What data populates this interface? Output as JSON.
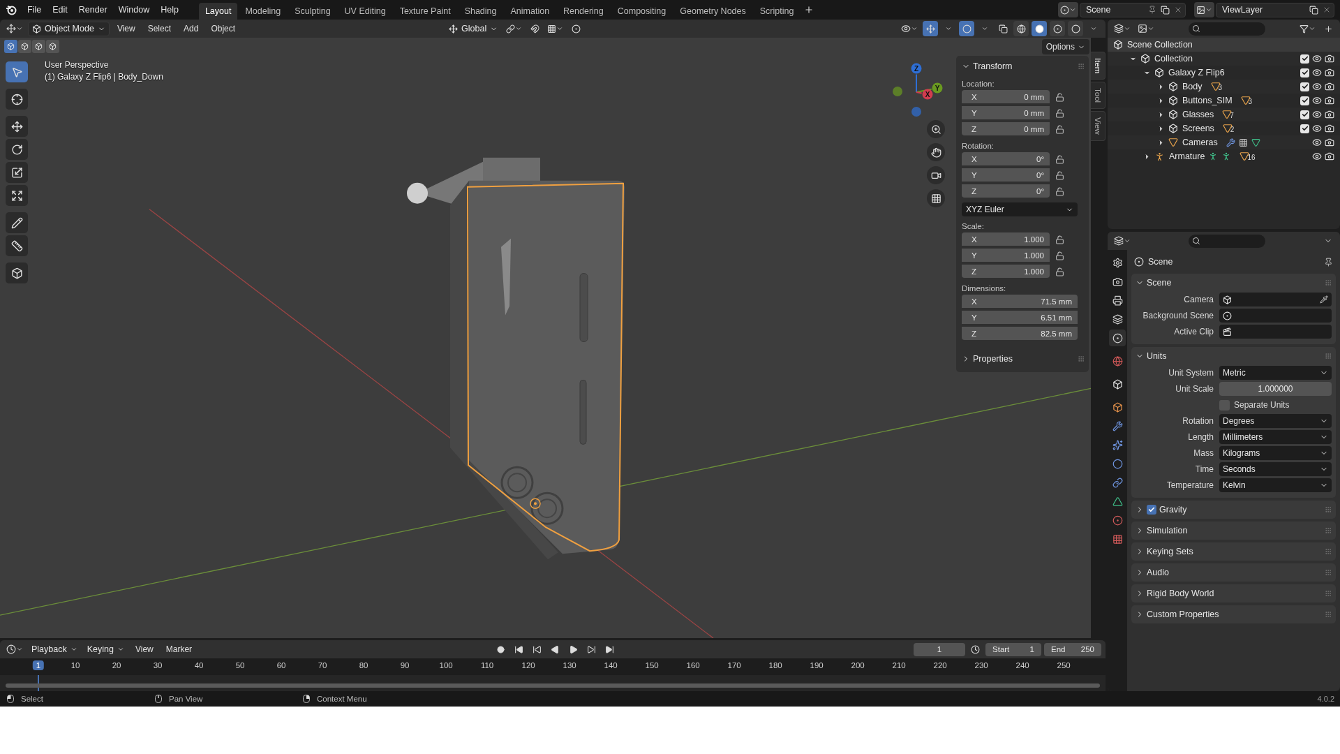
{
  "topbar": {
    "menus": [
      "File",
      "Edit",
      "Render",
      "Window",
      "Help"
    ],
    "workspaces": [
      {
        "label": "Layout",
        "selected": true
      },
      {
        "label": "Modeling",
        "selected": false
      },
      {
        "label": "Sculpting",
        "selected": false
      },
      {
        "label": "UV Editing",
        "selected": false
      },
      {
        "label": "Texture Paint",
        "selected": false
      },
      {
        "label": "Shading",
        "selected": false
      },
      {
        "label": "Animation",
        "selected": false
      },
      {
        "label": "Rendering",
        "selected": false
      },
      {
        "label": "Compositing",
        "selected": false
      },
      {
        "label": "Geometry Nodes",
        "selected": false
      },
      {
        "label": "Scripting",
        "selected": false
      }
    ],
    "scene": "Scene",
    "view_layer": "ViewLayer"
  },
  "viewport_header": {
    "mode": "Object Mode",
    "menus": [
      "View",
      "Select",
      "Add",
      "Object"
    ],
    "orientation": "Global"
  },
  "viewport": {
    "select_modes": [
      {
        "selected": true
      },
      {
        "selected": false
      },
      {
        "selected": false
      },
      {
        "selected": false
      }
    ],
    "tools": [
      {
        "kind": "select",
        "selected": true
      },
      {
        "kind": "cursor",
        "selected": false
      },
      {
        "kind": "move",
        "selected": false
      },
      {
        "kind": "rotate",
        "selected": false
      },
      {
        "kind": "scale",
        "selected": false
      },
      {
        "kind": "transform",
        "selected": false
      },
      {
        "kind": "annotate",
        "selected": false
      },
      {
        "kind": "measure",
        "selected": false
      },
      {
        "kind": "add-cube",
        "selected": false
      }
    ],
    "view_name": "User Perspective",
    "object_info": "(1) Galaxy Z Flip6 | Body_Down",
    "options": "Options",
    "gizmo": [
      {
        "label": "Z",
        "color": "#2e6fd6"
      },
      {
        "label": "Y",
        "color": "#6a9a20"
      },
      {
        "label": "X",
        "color": "#d23c4e"
      }
    ]
  },
  "sidebar": {
    "tabs": [
      {
        "label": "Item",
        "selected": true
      },
      {
        "label": "Tool",
        "selected": false
      },
      {
        "label": "View",
        "selected": false
      }
    ],
    "title": "Transform",
    "expanded": true,
    "sections": [
      {
        "kind": "vector",
        "label": "Location:",
        "fields": [
          {
            "axis": "X",
            "value": "0 mm",
            "locked": false
          },
          {
            "axis": "Y",
            "value": "0 mm",
            "locked": false
          },
          {
            "axis": "Z",
            "value": "0 mm",
            "locked": false
          }
        ]
      },
      {
        "kind": "vector",
        "label": "Rotation:",
        "fields": [
          {
            "axis": "X",
            "value": "0°",
            "locked": false
          },
          {
            "axis": "Y",
            "value": "0°",
            "locked": false
          },
          {
            "axis": "Z",
            "value": "0°",
            "locked": false
          }
        ]
      },
      {
        "kind": "dropdown",
        "value": "XYZ Euler"
      },
      {
        "kind": "vector",
        "label": "Scale:",
        "fields": [
          {
            "axis": "X",
            "value": "1.000",
            "locked": false
          },
          {
            "axis": "Y",
            "value": "1.000",
            "locked": false
          },
          {
            "axis": "Z",
            "value": "1.000",
            "locked": false
          }
        ]
      },
      {
        "kind": "vector",
        "label": "Dimensions:",
        "fields": [
          {
            "axis": "X",
            "value": "71.5 mm"
          },
          {
            "axis": "Y",
            "value": "6.51 mm"
          },
          {
            "axis": "Z",
            "value": "82.5 mm"
          }
        ]
      }
    ],
    "collapsed": [
      "Properties"
    ]
  },
  "outliner": {
    "items": [
      {
        "name": "Scene Collection",
        "kind": "scene-collection",
        "children": [
          {
            "name": "Collection",
            "kind": "collection",
            "expanded": true,
            "checked": true,
            "children": [
              {
                "name": "Galaxy Z Flip6",
                "kind": "collection",
                "expanded": true,
                "checked": true,
                "children": [
                  {
                    "name": "Body",
                    "kind": "collection",
                    "expanded": false,
                    "checked": true,
                    "badges": [
                      {
                        "kind": "mesh",
                        "count": "3"
                      }
                    ]
                  },
                  {
                    "name": "Buttons_SIM",
                    "kind": "collection",
                    "expanded": false,
                    "checked": true,
                    "badges": [
                      {
                        "kind": "mesh",
                        "count": "3"
                      }
                    ]
                  },
                  {
                    "name": "Glasses",
                    "kind": "collection",
                    "expanded": false,
                    "checked": true,
                    "badges": [
                      {
                        "kind": "mesh",
                        "count": "7"
                      }
                    ]
                  },
                  {
                    "name": "Screens",
                    "kind": "collection",
                    "expanded": false,
                    "checked": true,
                    "badges": [
                      {
                        "kind": "mesh",
                        "count": "2"
                      }
                    ]
                  },
                  {
                    "name": "Cameras",
                    "kind": "mesh-object",
                    "expanded": false,
                    "badges": [
                      {
                        "kind": "modifier"
                      },
                      {
                        "kind": "particles"
                      },
                      {
                        "kind": "mesh-data"
                      }
                    ]
                  }
                ]
              },
              {
                "name": "Armature",
                "kind": "armature",
                "expanded": false,
                "badges": [
                  {
                    "kind": "pose"
                  },
                  {
                    "kind": "pose"
                  },
                  {
                    "kind": "mesh",
                    "count": "16"
                  }
                ]
              }
            ]
          }
        ]
      }
    ]
  },
  "properties": {
    "tabs": [
      {
        "kind": "tool",
        "selected": false
      },
      {
        "kind": "render",
        "selected": false
      },
      {
        "kind": "output",
        "selected": false
      },
      {
        "kind": "view-layer",
        "selected": false
      },
      {
        "kind": "scene",
        "selected": true
      },
      {
        "kind": "world",
        "selected": false
      },
      {
        "kind": "collection",
        "selected": false
      },
      {
        "kind": "object",
        "selected": false
      },
      {
        "kind": "modifier",
        "selected": false
      },
      {
        "kind": "particles",
        "selected": false
      },
      {
        "kind": "physics",
        "selected": false
      },
      {
        "kind": "constraint",
        "selected": false
      },
      {
        "kind": "data",
        "selected": false
      },
      {
        "kind": "material",
        "selected": false
      },
      {
        "kind": "texture",
        "selected": false
      }
    ],
    "context": "Scene",
    "panels": [
      {
        "title": "Scene",
        "expanded": true,
        "rows": [
          {
            "kind": "camera-field",
            "label": "Camera"
          },
          {
            "kind": "scene-field",
            "label": "Background Scene"
          },
          {
            "kind": "clip-field",
            "label": "Active Clip"
          }
        ]
      },
      {
        "title": "Units",
        "expanded": true,
        "rows": [
          {
            "kind": "dropdown",
            "label": "Unit System",
            "value": "Metric"
          },
          {
            "kind": "number",
            "label": "Unit Scale",
            "value": "1.000000"
          },
          {
            "kind": "checkbox",
            "label": "Separate Units",
            "checked": false
          },
          {
            "kind": "dropdown",
            "label": "Rotation",
            "value": "Degrees"
          },
          {
            "kind": "dropdown",
            "label": "Length",
            "value": "Millimeters"
          },
          {
            "kind": "dropdown",
            "label": "Mass",
            "value": "Kilograms"
          },
          {
            "kind": "dropdown",
            "label": "Time",
            "value": "Seconds"
          },
          {
            "kind": "dropdown",
            "label": "Temperature",
            "value": "Kelvin"
          }
        ]
      },
      {
        "title": "Gravity",
        "expanded": false,
        "checked": true
      },
      {
        "title": "Simulation",
        "expanded": false
      },
      {
        "title": "Keying Sets",
        "expanded": false
      },
      {
        "title": "Audio",
        "expanded": false
      },
      {
        "title": "Rigid Body World",
        "expanded": false
      },
      {
        "title": "Custom Properties",
        "expanded": false
      }
    ]
  },
  "timeline": {
    "menus": [
      "Playback",
      "Keying",
      "View",
      "Marker"
    ],
    "current_frame": "1",
    "start_label": "Start",
    "start": "1",
    "end_label": "End",
    "end": "250",
    "ruler": {
      "current": "1",
      "ticks": [
        "10",
        "20",
        "30",
        "40",
        "50",
        "60",
        "70",
        "80",
        "90",
        "100",
        "110",
        "120",
        "130",
        "140",
        "150",
        "160",
        "170",
        "180",
        "190",
        "200",
        "210",
        "220",
        "230",
        "240",
        "250"
      ]
    }
  },
  "status_bar": {
    "hints": [
      {
        "kind": "left-mouse",
        "label": "Select"
      },
      {
        "kind": "middle-mouse",
        "label": "Pan View"
      },
      {
        "kind": "right-mouse",
        "label": "Context Menu"
      }
    ],
    "version": "4.0.2"
  }
}
